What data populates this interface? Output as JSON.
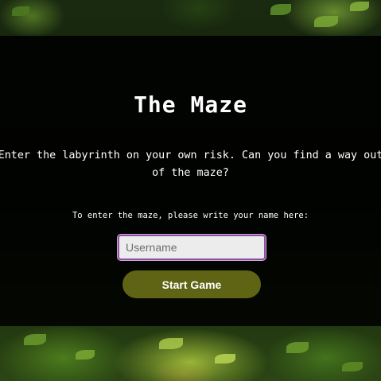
{
  "page": {
    "title": "The Maze",
    "description": "Enter the labyrinth on your own risk. Can you find a way out of the maze?",
    "prompt": "To enter the maze, please write your name here:"
  },
  "form": {
    "username_placeholder": "Username",
    "username_value": "",
    "start_label": "Start Game"
  },
  "colors": {
    "overlay": "#000000",
    "button": "#5f6314",
    "input_border": "#8e4fa5",
    "text": "#ffffff"
  },
  "background": {
    "image_name": "forest-path-background"
  }
}
